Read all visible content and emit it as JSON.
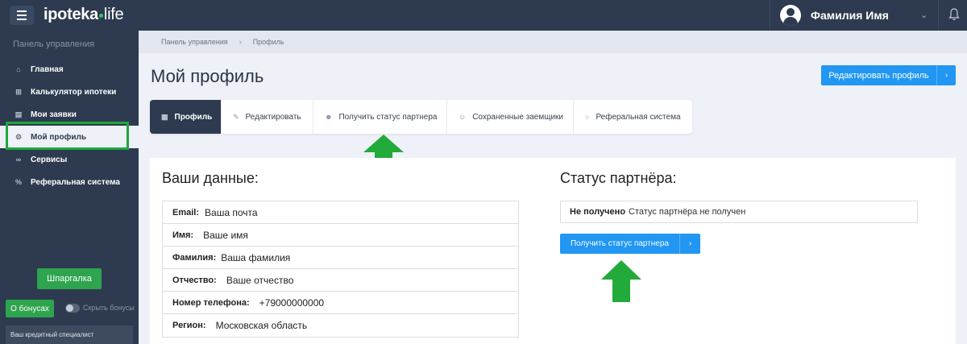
{
  "header": {
    "logo_main": "ipoteka",
    "logo_suffix": "life",
    "user_name": "Фамилия Имя",
    "user_menu_icon": "chevron-down-icon",
    "notification_icon": "bell-icon"
  },
  "sidebar": {
    "title": "Панель управления",
    "items": [
      {
        "label": "Главная",
        "icon": "home-icon"
      },
      {
        "label": "Калькулятор ипотеки",
        "icon": "calculator-icon"
      },
      {
        "label": "Мои заявки",
        "icon": "briefcase-icon"
      },
      {
        "label": "Мой профиль",
        "icon": "gear-icon",
        "active": true
      },
      {
        "label": "Сервисы",
        "icon": "link-icon"
      },
      {
        "label": "Реферальная система",
        "icon": "percent-icon"
      }
    ],
    "cheat_sheet_label": "Шпаргалка",
    "bonus_label": "О бонусах",
    "hide_bonus_label": "Скрыть бонусы",
    "specialist_label": "Ваш кредитный специалист"
  },
  "breadcrumb": [
    "Панель управления",
    "Профиль"
  ],
  "page": {
    "title": "Мой профиль",
    "edit_button": "Редактировать профиль"
  },
  "tabs": [
    {
      "label": "Профиль",
      "icon": "grid-icon",
      "active": true
    },
    {
      "label": "Редактировать",
      "icon": "edit-icon"
    },
    {
      "label": "Получить статус партнера",
      "icon": "user-plus-icon"
    },
    {
      "label": "Сохраненные заемщики",
      "icon": "users-icon"
    },
    {
      "label": "Реферальная система",
      "icon": "award-icon"
    }
  ],
  "profile": {
    "title": "Ваши данные:",
    "rows": [
      {
        "label": "Email:",
        "value": "Ваша почта"
      },
      {
        "label": "Имя:",
        "value": "Ваше имя"
      },
      {
        "label": "Фамилия:",
        "value": "Ваша фамилия"
      },
      {
        "label": "Отчество:",
        "value": "Ваше отчество"
      },
      {
        "label": "Номер телефона:",
        "value": "+79000000000"
      },
      {
        "label": "Регион:",
        "value": "Московская область"
      }
    ]
  },
  "partner": {
    "title": "Статус партнёра:",
    "status_key": "Не получено",
    "status_text": "Статус партнёра не получен",
    "button": "Получить статус партнера"
  },
  "colors": {
    "sidebar_bg": "#2d3a4f",
    "accent_blue": "#2196f3",
    "accent_green": "#2ea44f",
    "highlight_green": "#1ea83c"
  }
}
